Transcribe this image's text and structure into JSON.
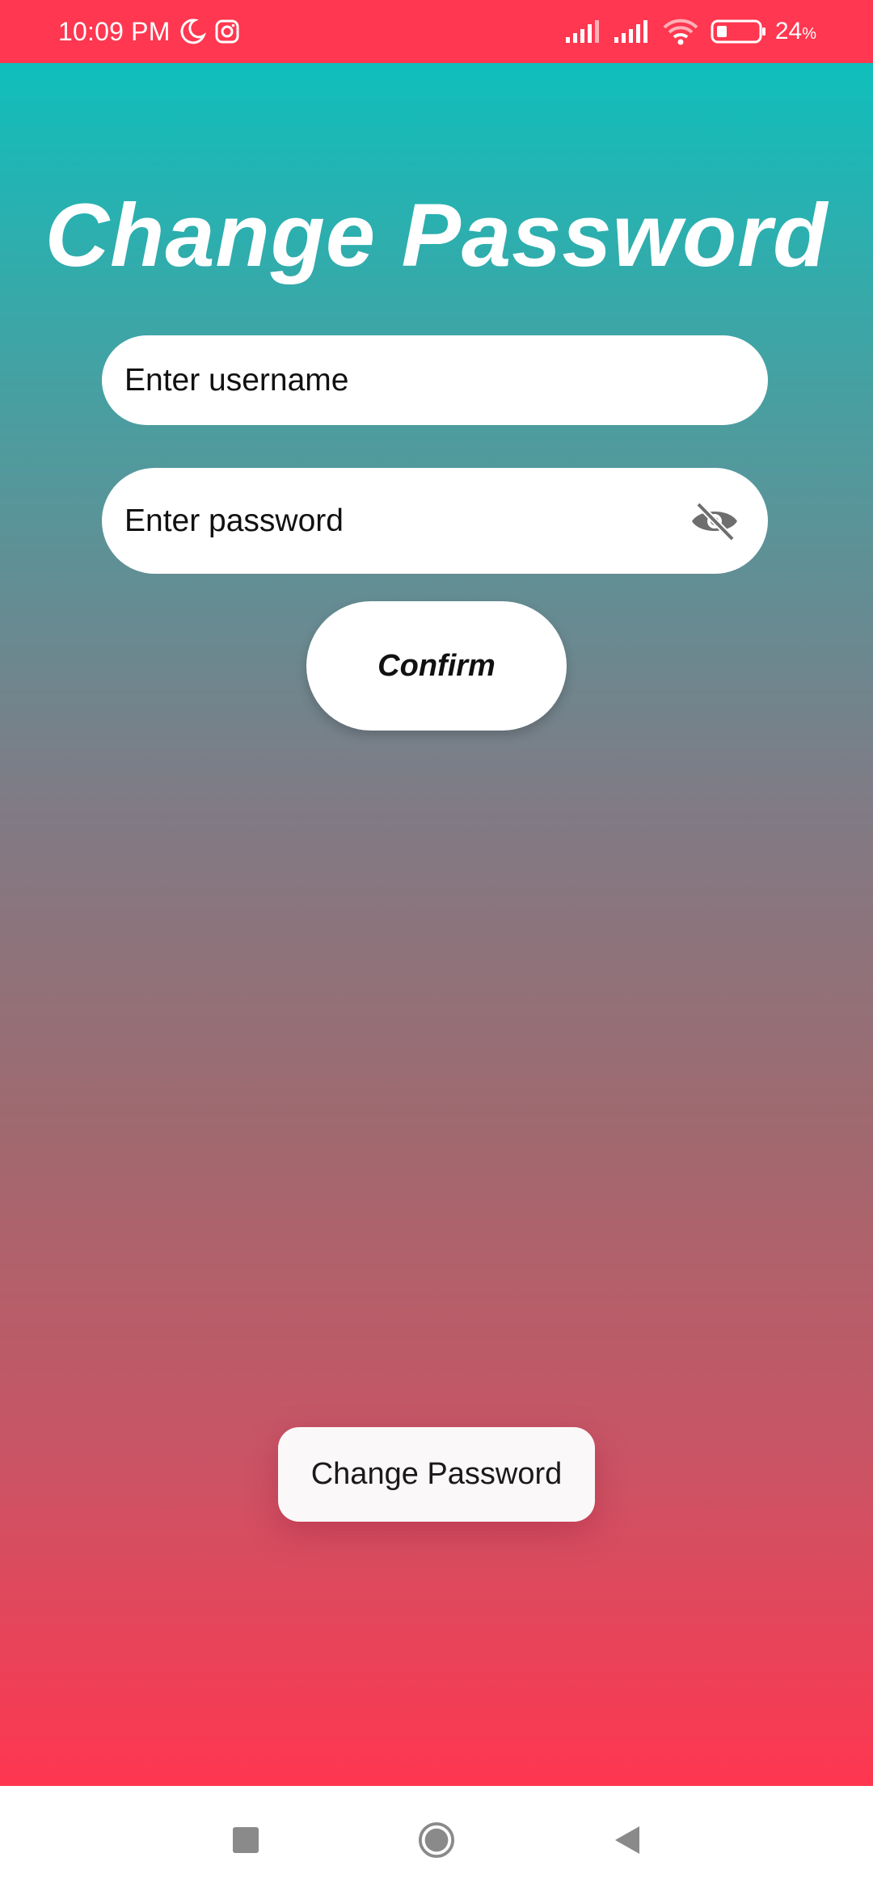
{
  "status_bar": {
    "time": "10:09 PM",
    "battery_percent": "24",
    "battery_unit": "%",
    "icons": [
      "moon-icon",
      "instagram-icon",
      "signal-icon",
      "signal-icon",
      "wifi-icon",
      "battery-icon"
    ]
  },
  "screen": {
    "title": "Change Password",
    "username_placeholder": "Enter username",
    "password_placeholder": "Enter password",
    "password_toggle_icon": "eye-off-icon",
    "confirm_label": "Confirm",
    "toast_message": "Change Password"
  },
  "nav_bar": {
    "icons": [
      "recents-icon",
      "home-icon",
      "back-icon"
    ]
  },
  "colors": {
    "status_bar": "#ff3750",
    "gradient_top": "#0fbfbc",
    "gradient_bottom": "#ff3650"
  }
}
